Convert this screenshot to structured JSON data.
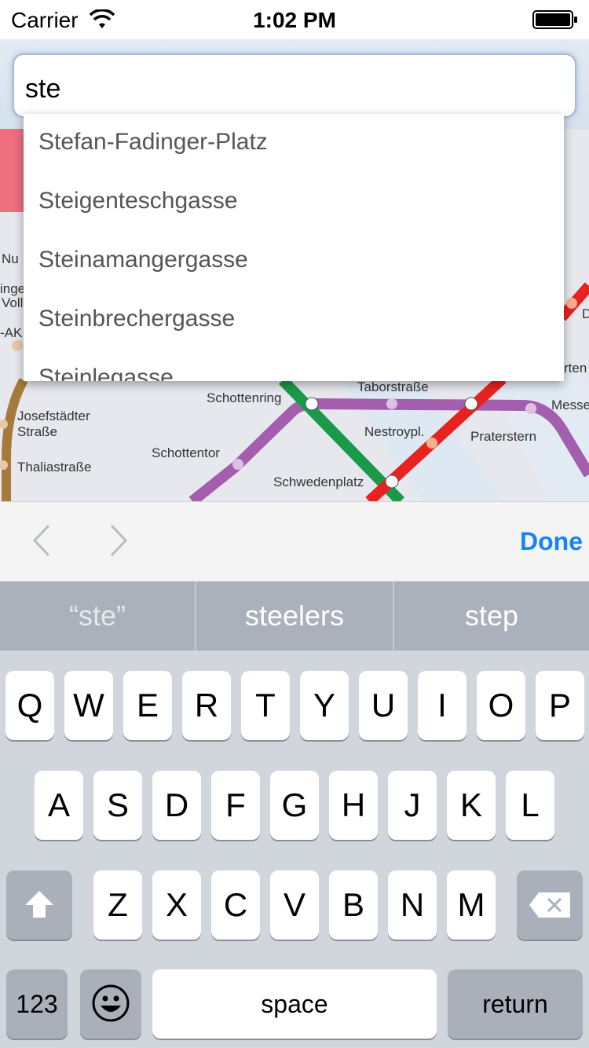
{
  "status_bar": {
    "carrier": "Carrier",
    "time": "1:02 PM"
  },
  "search": {
    "value": "ste"
  },
  "autocomplete": {
    "items": [
      "Stefan-Fadinger-Platz",
      "Steigenteschgasse",
      "Steinamangergasse",
      "Steinbrechergasse",
      "Steinlegasse"
    ]
  },
  "map": {
    "labels": {
      "josefstaedter": "Josefstädter",
      "strasse": "Straße",
      "thaliastrasse": "Thaliastraße",
      "schottenring": "Schottenring",
      "schottentor": "Schottentor",
      "taborstrasse": "Taborstraße",
      "nestroypl": "Nestroypl.",
      "praterstern": "Praterstern",
      "schwedenplatz": "Schwedenplatz",
      "messe": "Messe",
      "nu": "Nu",
      "inge": "inge",
      "voll": "Voll",
      "ak": "-AK",
      "d": "D",
      "rten": "rten"
    },
    "line_colors": {
      "u1": "#e8231f",
      "u2": "#a35fae",
      "u4": "#1a9a49",
      "u6": "#a67a3a"
    }
  },
  "accessory": {
    "done_label": "Done"
  },
  "keyboard": {
    "suggestions": [
      "“ste”",
      "steelers",
      "step"
    ],
    "row1": [
      "Q",
      "W",
      "E",
      "R",
      "T",
      "Y",
      "U",
      "I",
      "O",
      "P"
    ],
    "row2": [
      "A",
      "S",
      "D",
      "F",
      "G",
      "H",
      "J",
      "K",
      "L"
    ],
    "row3": [
      "Z",
      "X",
      "C",
      "V",
      "B",
      "N",
      "M"
    ],
    "numbers_label": "123",
    "space_label": "space",
    "return_label": "return"
  }
}
